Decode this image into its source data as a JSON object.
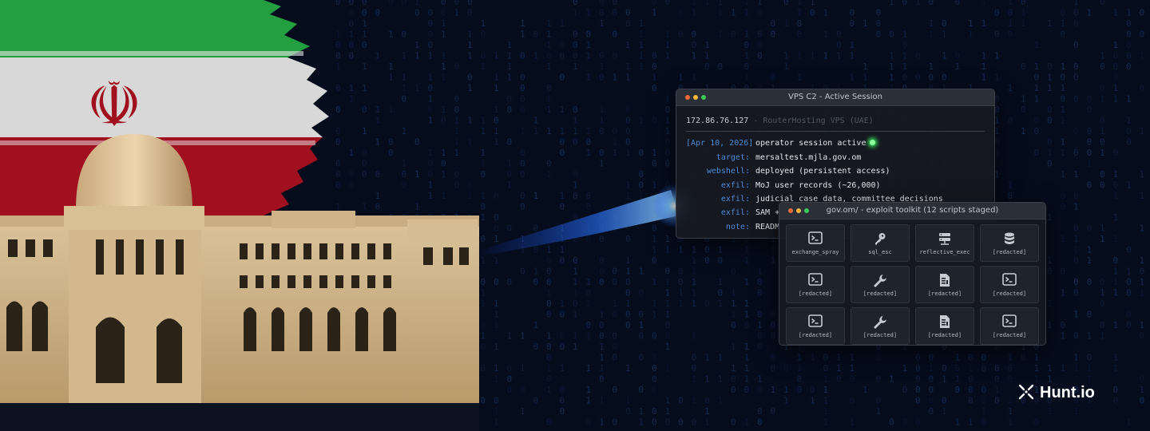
{
  "colors": {
    "accent_blue": "#4f8bd6",
    "live_green": "#3dff60",
    "flag_green": "#239f40",
    "flag_red": "#c8102e"
  },
  "terminal": {
    "title": "VPS C2 - Active Session",
    "ip": "172.86.76.127",
    "host": "- RouterHosting VPS (UAE)",
    "lines": [
      {
        "key": "[Apr 10, 2026]",
        "value": "operator session active"
      },
      {
        "key": "target:",
        "value": "mersaltest.mjla.gov.om"
      },
      {
        "key": "webshell:",
        "value": "deployed (persistent access)"
      },
      {
        "key": "exfil:",
        "value": "MoJ user records (~26,000)"
      },
      {
        "key": "exfil:",
        "value": "judicial case data, committee decisions"
      },
      {
        "key": "exfil:",
        "value": "SAM +"
      },
      {
        "key": "note:",
        "value": "READM"
      }
    ]
  },
  "toolkit": {
    "title": "gov.om/ - exploit toolkit (12 scripts staged)",
    "items": [
      {
        "label": "exchange_spray",
        "icon": "terminal-icon"
      },
      {
        "label": "sql_esc",
        "icon": "key-icon"
      },
      {
        "label": "reflective_exec",
        "icon": "server-icon"
      },
      {
        "label": "[redacted]",
        "icon": "database-icon"
      },
      {
        "label": "[redacted]",
        "icon": "terminal-icon"
      },
      {
        "label": "[redacted]",
        "icon": "wrench-icon"
      },
      {
        "label": "[redacted]",
        "icon": "file-icon"
      },
      {
        "label": "[redacted]",
        "icon": "terminal-icon"
      },
      {
        "label": "[redacted]",
        "icon": "terminal-icon"
      },
      {
        "label": "[redacted]",
        "icon": "wrench-icon"
      },
      {
        "label": "[redacted]",
        "icon": "file-icon"
      },
      {
        "label": "[redacted]",
        "icon": "terminal-icon"
      }
    ]
  },
  "brand": {
    "name": "Hunt.io"
  }
}
